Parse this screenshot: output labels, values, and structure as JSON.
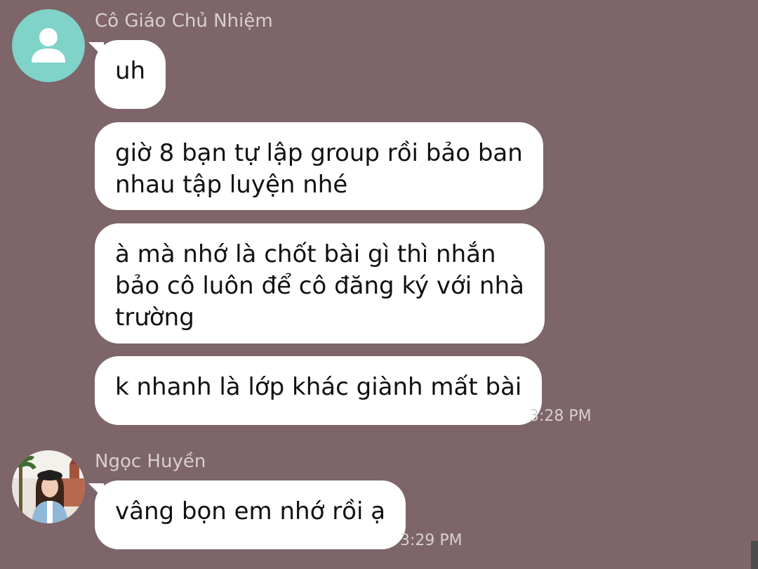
{
  "theme": {
    "background": "#7d6569",
    "bubble": "#ffffff",
    "meta_text": "#d9cfd1",
    "teacher_avatar_bg": "#7fd3c8"
  },
  "messages": {
    "teacher": {
      "name": "Cô Giáo Chủ Nhiệm",
      "avatar_icon": "person-icon",
      "bubbles": [
        {
          "lines": [
            "uh"
          ]
        },
        {
          "lines": [
            "giờ 8 bạn tự lập group rồi bảo ban",
            "nhau tập luyện nhé"
          ]
        },
        {
          "lines": [
            "à mà nhớ là chốt bài gì thì nhắn",
            "bảo cô luôn để cô đăng ký với nhà",
            "trường"
          ]
        },
        {
          "lines": [
            "k nhanh là lớp khác giành mất bài"
          ]
        }
      ],
      "time": "3:28 PM"
    },
    "student": {
      "name": "Ngọc Huyền",
      "avatar_icon": "profile-photo",
      "bubbles": [
        {
          "lines": [
            "vâng bọn em nhớ rồi ạ"
          ]
        }
      ],
      "time": "3:29 PM"
    }
  }
}
